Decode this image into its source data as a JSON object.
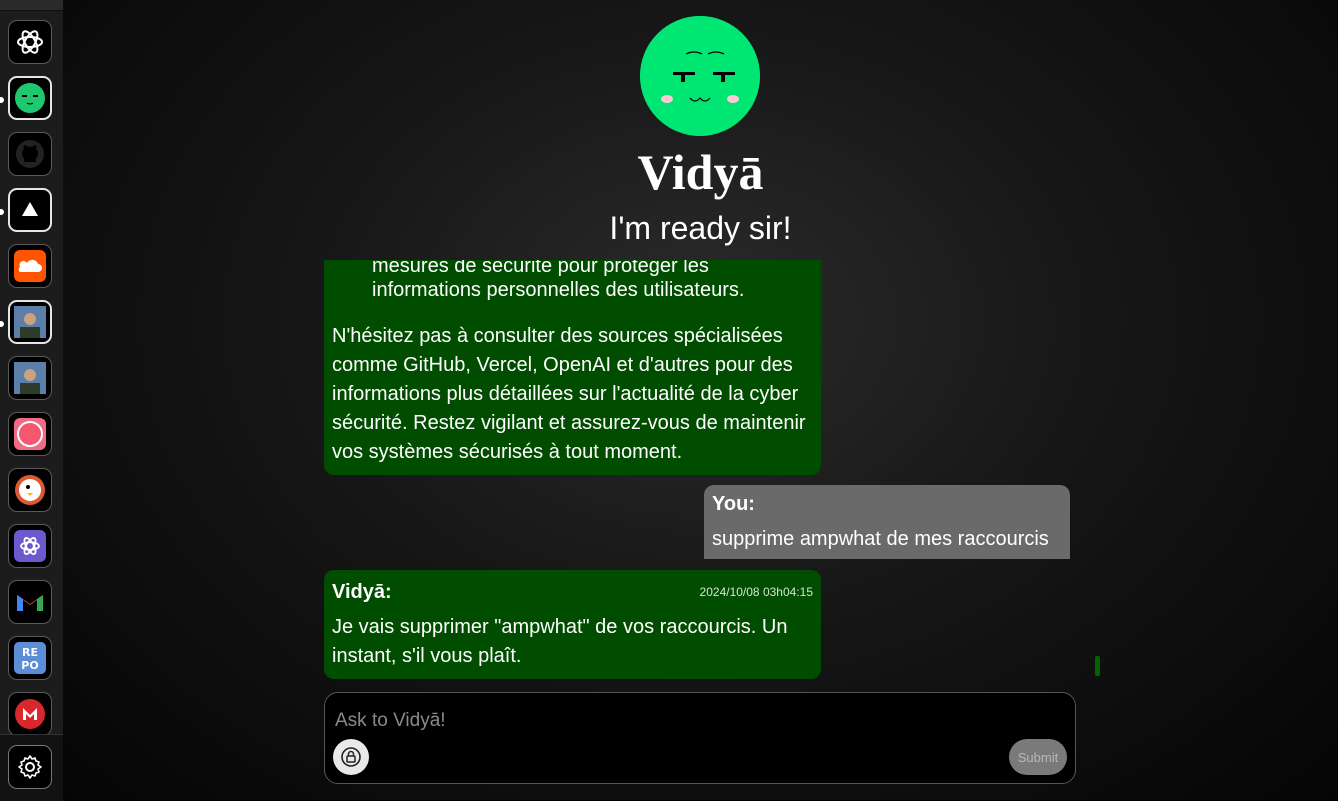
{
  "sidebar": {
    "apps": [
      {
        "icon": "openai-icon"
      },
      {
        "icon": "vidya-avatar-icon"
      },
      {
        "icon": "github-icon"
      },
      {
        "icon": "vercel-icon"
      },
      {
        "icon": "soundcloud-icon"
      },
      {
        "icon": "profile-photo-icon"
      },
      {
        "icon": "profile-photo-icon"
      },
      {
        "icon": "pink-circle-app-icon"
      },
      {
        "icon": "duckduckgo-icon"
      },
      {
        "icon": "openai-purple-icon"
      },
      {
        "icon": "gmail-icon"
      },
      {
        "icon": "repo-icon"
      },
      {
        "icon": "mega-icon"
      }
    ],
    "settings_icon": "gear-icon"
  },
  "header": {
    "name": "Vidyā",
    "tagline": "I'm ready sir!"
  },
  "chat": {
    "messages": [
      {
        "sender": "",
        "list_tail": "mesures de sécurité pour protéger les informations personnelles des utilisateurs.",
        "text": "N'hésitez pas à consulter des sources spécialisées comme GitHub, Vercel, OpenAI et d'autres pour des informations plus détaillées sur l'actualité de la cyber sécurité. Restez vigilant et assurez-vous de maintenir vos systèmes sécurisés à tout moment."
      },
      {
        "sender": "You:",
        "text": "supprime ampwhat de mes raccourcis"
      },
      {
        "sender": "Vidyā:",
        "timestamp": "2024/10/08 03h04:15",
        "text": "Je vais supprimer \"ampwhat\" de vos raccourcis. Un instant, s'il vous plaît."
      }
    ]
  },
  "composer": {
    "placeholder": "Ask to Vidyā!",
    "submit_label": "Submit",
    "attach_icon": "lock-circle-icon"
  },
  "colors": {
    "assistant_bubble": "#004d00",
    "user_bubble": "#6a6a6a",
    "avatar": "#00e673"
  }
}
